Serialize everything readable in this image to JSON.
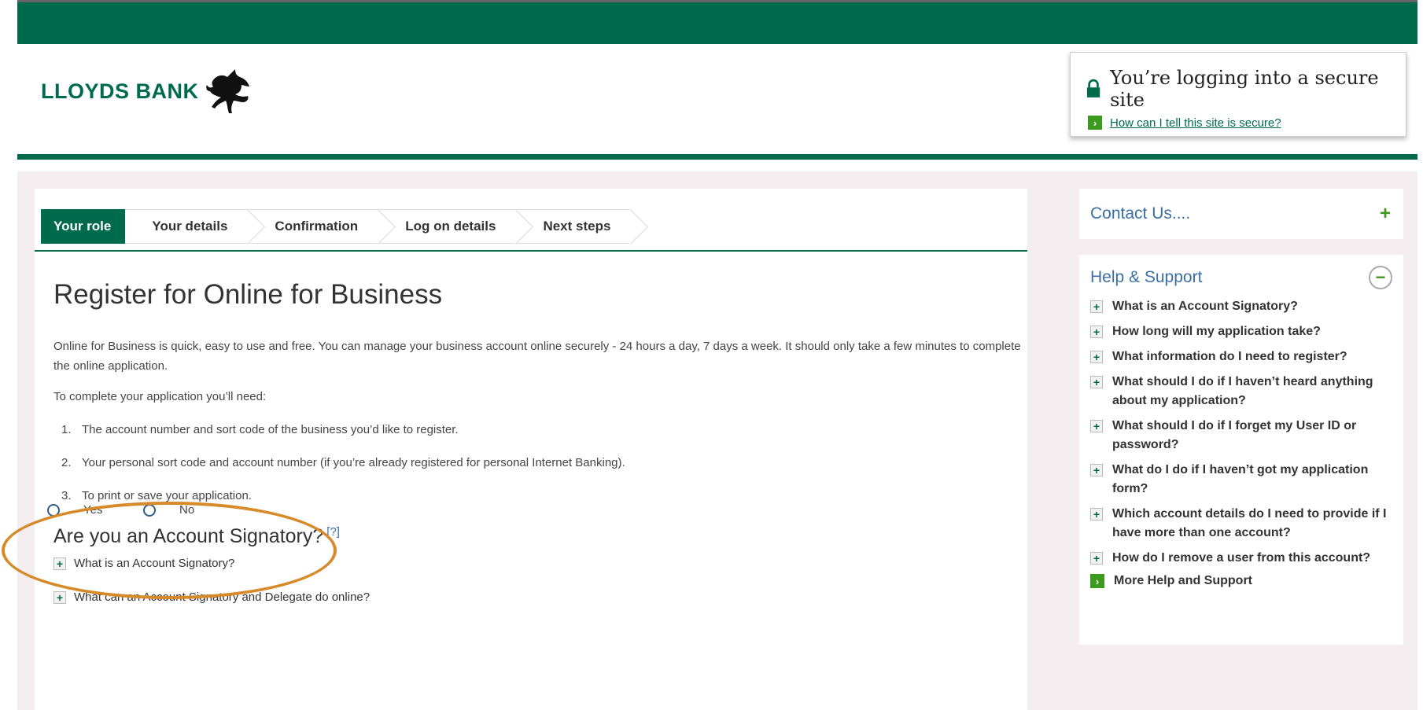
{
  "brand": {
    "name": "LLOYDS BANK",
    "color": "#006a4d",
    "accent": "#3c9a1e"
  },
  "secure": {
    "title": "You’re logging into a secure site",
    "link": "How can I tell this site is secure?"
  },
  "steps": [
    {
      "label": "Your role",
      "active": true
    },
    {
      "label": "Your details"
    },
    {
      "label": "Confirmation"
    },
    {
      "label": "Log on details"
    },
    {
      "label": "Next steps"
    }
  ],
  "main": {
    "title": "Register for Online for Business",
    "intro": "Online for Business is quick, easy to use and free. You can manage your business account online securely - 24 hours a day, 7 days a week. It should only take a few minutes to complete the online application.",
    "need": "To complete your application you’ll need:",
    "requirements": [
      {
        "num": "1.",
        "text": "The account number and sort code of the business you’d like to register."
      },
      {
        "num": "2.",
        "text": "Your personal sort code and account number (if you’re already registered for personal Internet Banking)."
      },
      {
        "num": "3.",
        "text": "To print or save your application."
      }
    ],
    "question": "Are you an Account Signatory?",
    "question_help": "[?]",
    "options": [
      "Yes",
      "No"
    ],
    "faq": [
      "What is an Account Signatory?",
      "What can an Account Signatory and Delegate do online?"
    ]
  },
  "sidebar": {
    "contact_title": "Contact Us....",
    "contact_toggle": "+",
    "help_title": "Help & Support",
    "help_toggle": "−",
    "help_items": [
      "What is an Account Signatory?",
      "How long will my application take?",
      "What information do I need to register?",
      "What should I do if I haven’t heard anything about my application?",
      "What should I do if I forget my User ID or password?",
      "What do I do if I haven’t got my application form?",
      "Which account details do I need to provide if I have more than one account?",
      "How do I remove a user from this account?"
    ],
    "more_help": "More Help and Support"
  }
}
